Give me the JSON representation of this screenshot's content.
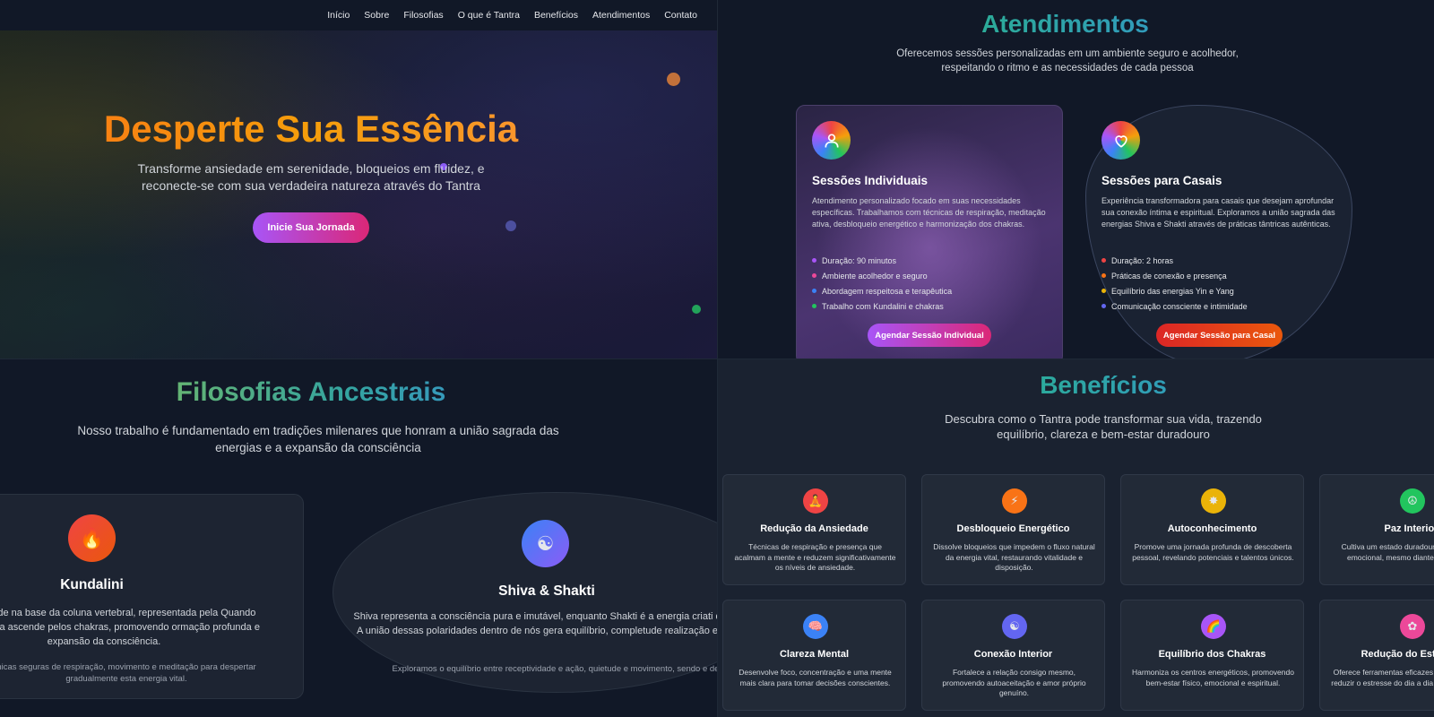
{
  "nav": {
    "items": [
      "Início",
      "Sobre",
      "Filosofias",
      "O que é Tantra",
      "Benefícios",
      "Atendimentos",
      "Contato"
    ]
  },
  "hero": {
    "title": "Desperte Sua Essência",
    "subtitle": "Transforme ansiedade em serenidade, bloqueios em fluidez, e reconecte-se com sua verdadeira natureza através do Tantra",
    "cta": "Inicie Sua Jornada"
  },
  "atendimentos": {
    "title": "Atendimentos",
    "subtitle": "Oferecemos sessões personalizadas em um ambiente seguro e acolhedor, respeitando o ritmo e as necessidades de cada pessoa",
    "cards": [
      {
        "icon": "user-icon",
        "title": "Sessões Individuais",
        "description": "Atendimento personalizado focado em suas necessidades específicas. Trabalhamos com técnicas de respiração, meditação ativa, desbloqueio energético e harmonização dos chakras.",
        "features": [
          "Duração: 90 minutos",
          "Ambiente acolhedor e seguro",
          "Abordagem respeitosa e terapêutica",
          "Trabalho com Kundalini e chakras"
        ],
        "bullet_colors": [
          "#a855f7",
          "#ec4899",
          "#3b82f6",
          "#22c55e"
        ],
        "button": "Agendar Sessão Individual"
      },
      {
        "icon": "heart-icon",
        "title": "Sessões para Casais",
        "description": "Experiência transformadora para casais que desejam aprofundar sua conexão íntima e espiritual. Exploramos a união sagrada das energias Shiva e Shakti através de práticas tântricas autênticas.",
        "features": [
          "Duração: 2 horas",
          "Práticas de conexão e presença",
          "Equilíbrio das energias Yin e Yang",
          "Comunicação consciente e intimidade"
        ],
        "bullet_colors": [
          "#ef4444",
          "#f97316",
          "#eab308",
          "#6366f1"
        ],
        "button": "Agendar Sessão para Casal"
      }
    ]
  },
  "filosofias": {
    "title": "Filosofias Ancestrais",
    "subtitle": "Nosso trabalho é fundamentado em tradições milenares que honram a união sagrada das energias e a expansão da consciência",
    "cards": [
      {
        "icon": "🔥",
        "title": "Kundalini",
        "description": "al que reside na base da coluna vertebral, representada pela Quando desperta, ela ascende pelos chakras, promovendo ormação profunda e expansão da consciência.",
        "note": "nicas seguras de respiração, movimento e meditação para despertar gradualmente esta energia vital."
      },
      {
        "icon": "☯",
        "title": "Shiva & Shakti",
        "description": "Shiva representa a consciência pura e imutável, enquanto Shakti é a energia criati dinâmica. A união dessas polaridades dentro de nós gera equilíbrio, completude realização espiritual.",
        "note": "Exploramos o equilíbrio entre receptividade e ação, quietude e movimento, sendo e devir"
      }
    ]
  },
  "beneficios": {
    "title": "Benefícios",
    "subtitle": "Descubra como o Tantra pode transformar sua vida, trazendo equilíbrio, clareza e bem-estar duradouro",
    "cards": [
      {
        "icon": "🧘",
        "color": "#ef4444",
        "title": "Redução da Ansiedade",
        "description": "Técnicas de respiração e presença que acalmam a mente e reduzem significativamente os níveis de ansiedade."
      },
      {
        "icon": "⚡",
        "color": "#f97316",
        "title": "Desbloqueio Energético",
        "description": "Dissolve bloqueios que impedem o fluxo natural da energia vital, restaurando vitalidade e disposição."
      },
      {
        "icon": "✸",
        "color": "#eab308",
        "title": "Autoconhecimento",
        "description": "Promove uma jornada profunda de descoberta pessoal, revelando potenciais e talentos únicos."
      },
      {
        "icon": "☮",
        "color": "#22c55e",
        "title": "Paz Interior",
        "description": "Cultiva um estado duradouro de equilíbrio emocional, mesmo diante de desafios."
      },
      {
        "icon": "🧠",
        "color": "#3b82f6",
        "title": "Clareza Mental",
        "description": "Desenvolve foco, concentração e uma mente mais clara para tomar decisões conscientes."
      },
      {
        "icon": "☯",
        "color": "#6366f1",
        "title": "Conexão Interior",
        "description": "Fortalece a relação consigo mesmo, promovendo autoaceitação e amor próprio genuíno."
      },
      {
        "icon": "🌈",
        "color": "#a855f7",
        "title": "Equilíbrio dos Chakras",
        "description": "Harmoniza os centros energéticos, promovendo bem-estar físico, emocional e espiritual."
      },
      {
        "icon": "✿",
        "color": "#ec4899",
        "title": "Redução do Estresse",
        "description": "Oferece ferramentas eficazes para gerenciar e reduzir o estresse do dia a dia de forma natural."
      }
    ]
  }
}
